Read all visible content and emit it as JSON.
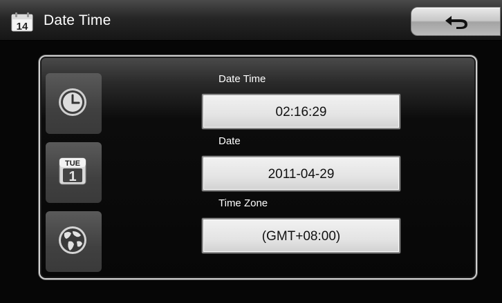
{
  "header": {
    "title": "Date Time",
    "calendar_icon_day": "14",
    "icon": "calendar-icon"
  },
  "back_button": {
    "icon": "back-arrow-icon"
  },
  "sidebar": {
    "items": [
      {
        "icon": "clock-icon"
      },
      {
        "icon": "calendar-day-icon",
        "weekday": "TUE",
        "day": "1"
      },
      {
        "icon": "globe-icon"
      }
    ]
  },
  "fields": [
    {
      "label": "Date Time",
      "value": "02:16:29"
    },
    {
      "label": "Date",
      "value": "2011-04-29"
    },
    {
      "label": "Time Zone",
      "value": "(GMT+08:00)"
    }
  ],
  "colors": {
    "background": "#060606",
    "header_top": "#4a4a4a",
    "panel_border": "#cfcfcf",
    "field_bg": "#e4e4e4",
    "text": "#ffffff"
  }
}
